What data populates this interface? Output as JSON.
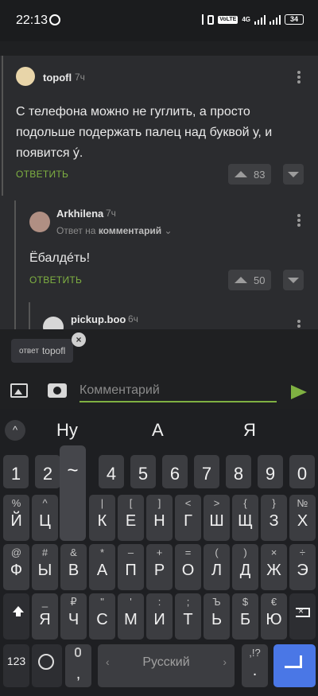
{
  "status_bar": {
    "time": "22:13",
    "volte": "VoLTE",
    "net": "4G",
    "battery": "34"
  },
  "comments": [
    {
      "author": "topofl",
      "age": "7ч",
      "text": "С телефона можно не гуглить, а просто подольше подержать палец над буквой у, и появится ý.",
      "reply_label": "ОТВЕТИТЬ",
      "votes": "83"
    },
    {
      "author": "Arkhilena",
      "age": "7ч",
      "reply_prefix": "Ответ на",
      "reply_target": "комментарий",
      "text": "Ёбалдéть!",
      "reply_label": "ОТВЕТИТЬ",
      "votes": "50"
    },
    {
      "author": "pickup.boo",
      "age": "6ч"
    }
  ],
  "reply_chip": {
    "prefix": "ответ",
    "name": "topofl",
    "close": "×"
  },
  "comment_input": {
    "placeholder": "Комментарий"
  },
  "keyboard": {
    "collapse": "^",
    "suggestions": [
      "Ну",
      "А",
      "Я"
    ],
    "number_row": [
      "1",
      "2",
      "~",
      "4",
      "5",
      "6",
      "7",
      "8",
      "9",
      "0"
    ],
    "row1": [
      {
        "main": "Й",
        "sup": "%"
      },
      {
        "main": "Ц",
        "sup": "^"
      },
      {
        "main": "",
        "sup": ""
      },
      {
        "main": "К",
        "sup": "|"
      },
      {
        "main": "Е",
        "sup": "["
      },
      {
        "main": "Н",
        "sup": "]"
      },
      {
        "main": "Г",
        "sup": "<"
      },
      {
        "main": "Ш",
        "sup": ">"
      },
      {
        "main": "Щ",
        "sup": "{"
      },
      {
        "main": "З",
        "sup": "}"
      },
      {
        "main": "Х",
        "sup": "№"
      }
    ],
    "row2": [
      {
        "main": "Ф",
        "sup": "@"
      },
      {
        "main": "Ы",
        "sup": "#"
      },
      {
        "main": "В",
        "sup": "&"
      },
      {
        "main": "А",
        "sup": "*"
      },
      {
        "main": "П",
        "sup": "–"
      },
      {
        "main": "Р",
        "sup": "+"
      },
      {
        "main": "О",
        "sup": "="
      },
      {
        "main": "Л",
        "sup": "("
      },
      {
        "main": "Д",
        "sup": ")"
      },
      {
        "main": "Ж",
        "sup": "×"
      },
      {
        "main": "Э",
        "sup": "÷"
      }
    ],
    "row3": [
      {
        "main": "Я",
        "sup": "_"
      },
      {
        "main": "Ч",
        "sup": "₽"
      },
      {
        "main": "С",
        "sup": "\""
      },
      {
        "main": "М",
        "sup": "'"
      },
      {
        "main": "И",
        "sup": ":"
      },
      {
        "main": "Т",
        "sup": ";"
      },
      {
        "main": "Ь",
        "sup": "Ъ"
      },
      {
        "main": "Б",
        "sup": "$"
      },
      {
        "main": "Ю",
        "sup": "€"
      }
    ],
    "fn_123": "123",
    "comma": ",",
    "space_label": "Русский",
    "period": ".",
    "period_sup": ",!?"
  }
}
